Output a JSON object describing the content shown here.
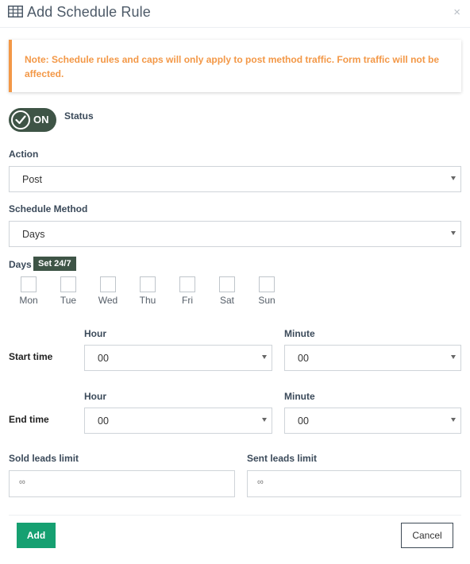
{
  "header": {
    "title": "Add Schedule Rule",
    "title_icon": "table-grid-icon",
    "close_symbol": "×"
  },
  "note": {
    "text": "Note: Schedule rules and caps will only apply to post method traffic. Form traffic will not be affected."
  },
  "status": {
    "toggle_text": "ON",
    "label": "Status",
    "on": true
  },
  "action": {
    "label": "Action",
    "value": "Post"
  },
  "schedule_method": {
    "label": "Schedule Method",
    "value": "Days"
  },
  "days": {
    "label": "Days",
    "set_label": "Set 24/7",
    "items": [
      {
        "name": "Mon",
        "checked": false
      },
      {
        "name": "Tue",
        "checked": false
      },
      {
        "name": "Wed",
        "checked": false
      },
      {
        "name": "Thu",
        "checked": false
      },
      {
        "name": "Fri",
        "checked": false
      },
      {
        "name": "Sat",
        "checked": false
      },
      {
        "name": "Sun",
        "checked": false
      }
    ]
  },
  "start_time": {
    "label": "Start time",
    "hour_label": "Hour",
    "hour_value": "00",
    "minute_label": "Minute",
    "minute_value": "00"
  },
  "end_time": {
    "label": "End time",
    "hour_label": "Hour",
    "hour_value": "00",
    "minute_label": "Minute",
    "minute_value": "00"
  },
  "limits": {
    "sold_label": "Sold leads limit",
    "sold_placeholder": "∞",
    "sent_label": "Sent leads limit",
    "sent_placeholder": "∞"
  },
  "footer": {
    "add_label": "Add",
    "cancel_label": "Cancel"
  },
  "colors": {
    "accent_green": "#16a071",
    "toggle_dark": "#3e5446",
    "note_orange": "#f39847"
  }
}
